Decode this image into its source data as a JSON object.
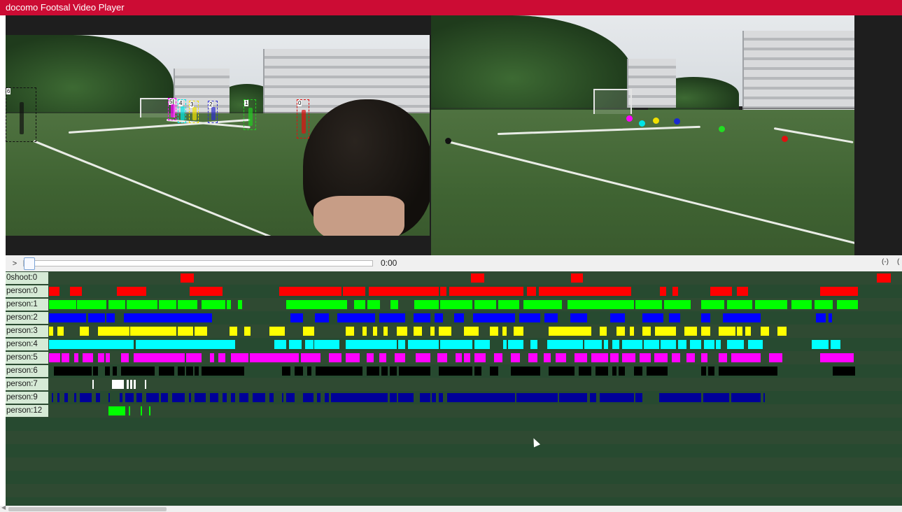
{
  "window": {
    "title": "docomo Footsal Video Player"
  },
  "controls": {
    "play_label": ">",
    "time": "0:00",
    "zoom_out_label": "(-)",
    "zoom_in_label": "("
  },
  "left_video": {
    "players": [
      {
        "id": "6",
        "color": "#111111"
      },
      {
        "id": "5",
        "color": "#ff00ff"
      },
      {
        "id": "4",
        "color": "#00e5e5"
      },
      {
        "id": "3",
        "color": "#f0e000"
      },
      {
        "id": "2",
        "color": "#2d2dcc"
      },
      {
        "id": "1",
        "color": "#22cc22"
      },
      {
        "id": "0",
        "color": "#e01010"
      }
    ]
  },
  "right_video": {
    "markers": [
      {
        "name": "person-6",
        "color": "#111111"
      },
      {
        "name": "person-5",
        "color": "#ff00ff"
      },
      {
        "name": "person-4",
        "color": "#00e5e5"
      },
      {
        "name": "person-3",
        "color": "#f0e000"
      },
      {
        "name": "person-2",
        "color": "#1a2ad0"
      },
      {
        "name": "person-1",
        "color": "#22dd22"
      },
      {
        "name": "person-0",
        "color": "#e01010"
      }
    ]
  },
  "timeline": {
    "rows": [
      {
        "label": "0shoot:0",
        "color": "#ff0000",
        "segments": [
          [
            0.155,
            0.171
          ],
          [
            0.498,
            0.514
          ],
          [
            0.616,
            0.63
          ],
          [
            0.977,
            0.993
          ]
        ]
      },
      {
        "label": "person:0",
        "color": "#ff0000",
        "segments": [
          [
            0.0,
            0.012
          ],
          [
            0.025,
            0.039
          ],
          [
            0.08,
            0.115
          ],
          [
            0.166,
            0.205
          ],
          [
            0.272,
            0.345
          ],
          [
            0.347,
            0.373
          ],
          [
            0.377,
            0.46
          ],
          [
            0.462,
            0.469
          ],
          [
            0.472,
            0.56
          ],
          [
            0.564,
            0.575
          ],
          [
            0.578,
            0.65
          ],
          [
            0.65,
            0.665
          ],
          [
            0.62,
            0.648
          ],
          [
            0.65,
            0.687
          ],
          [
            0.721,
            0.728
          ],
          [
            0.736,
            0.742
          ],
          [
            0.78,
            0.806
          ],
          [
            0.812,
            0.825
          ],
          [
            0.91,
            0.955
          ]
        ]
      },
      {
        "label": "person:1",
        "color": "#00ff00",
        "segments": [
          [
            0.0,
            0.032
          ],
          [
            0.033,
            0.068
          ],
          [
            0.07,
            0.09
          ],
          [
            0.092,
            0.128
          ],
          [
            0.13,
            0.15
          ],
          [
            0.152,
            0.175
          ],
          [
            0.18,
            0.208
          ],
          [
            0.21,
            0.215
          ],
          [
            0.223,
            0.228
          ],
          [
            0.28,
            0.33
          ],
          [
            0.33,
            0.352
          ],
          [
            0.36,
            0.373
          ],
          [
            0.376,
            0.391
          ],
          [
            0.403,
            0.412
          ],
          [
            0.431,
            0.46
          ],
          [
            0.462,
            0.5
          ],
          [
            0.502,
            0.528
          ],
          [
            0.53,
            0.555
          ],
          [
            0.56,
            0.605
          ],
          [
            0.612,
            0.69
          ],
          [
            0.692,
            0.723
          ],
          [
            0.726,
            0.757
          ],
          [
            0.77,
            0.797
          ],
          [
            0.8,
            0.83
          ],
          [
            0.833,
            0.871
          ],
          [
            0.876,
            0.9
          ],
          [
            0.903,
            0.925
          ],
          [
            0.93,
            0.955
          ]
        ]
      },
      {
        "label": "person:2",
        "color": "#0000ff",
        "segments": [
          [
            0.0,
            0.044
          ],
          [
            0.046,
            0.066
          ],
          [
            0.068,
            0.078
          ],
          [
            0.088,
            0.15
          ],
          [
            0.15,
            0.192
          ],
          [
            0.285,
            0.3
          ],
          [
            0.314,
            0.33
          ],
          [
            0.34,
            0.385
          ],
          [
            0.39,
            0.42
          ],
          [
            0.43,
            0.45
          ],
          [
            0.455,
            0.465
          ],
          [
            0.478,
            0.49
          ],
          [
            0.5,
            0.55
          ],
          [
            0.555,
            0.58
          ],
          [
            0.585,
            0.6
          ],
          [
            0.615,
            0.635
          ],
          [
            0.662,
            0.68
          ],
          [
            0.7,
            0.725
          ],
          [
            0.732,
            0.745
          ],
          [
            0.77,
            0.78
          ],
          [
            0.795,
            0.84
          ],
          [
            0.905,
            0.917
          ],
          [
            0.92,
            0.924
          ]
        ]
      },
      {
        "label": "person:3",
        "color": "#ffff00",
        "segments": [
          [
            0.0,
            0.005
          ],
          [
            0.01,
            0.017
          ],
          [
            0.036,
            0.047
          ],
          [
            0.058,
            0.095
          ],
          [
            0.096,
            0.15
          ],
          [
            0.152,
            0.17
          ],
          [
            0.172,
            0.187
          ],
          [
            0.213,
            0.222
          ],
          [
            0.23,
            0.238
          ],
          [
            0.26,
            0.278
          ],
          [
            0.3,
            0.313
          ],
          [
            0.35,
            0.36
          ],
          [
            0.37,
            0.375
          ],
          [
            0.382,
            0.387
          ],
          [
            0.395,
            0.4
          ],
          [
            0.41,
            0.423
          ],
          [
            0.43,
            0.44
          ],
          [
            0.45,
            0.455
          ],
          [
            0.46,
            0.475
          ],
          [
            0.49,
            0.507
          ],
          [
            0.52,
            0.53
          ],
          [
            0.535,
            0.54
          ],
          [
            0.548,
            0.56
          ],
          [
            0.59,
            0.64
          ],
          [
            0.65,
            0.658
          ],
          [
            0.67,
            0.68
          ],
          [
            0.685,
            0.69
          ],
          [
            0.7,
            0.71
          ],
          [
            0.715,
            0.74
          ],
          [
            0.75,
            0.765
          ],
          [
            0.77,
            0.78
          ],
          [
            0.79,
            0.81
          ],
          [
            0.812,
            0.818
          ],
          [
            0.822,
            0.828
          ],
          [
            0.84,
            0.85
          ],
          [
            0.86,
            0.87
          ]
        ]
      },
      {
        "label": "person:4",
        "color": "#00ffff",
        "segments": [
          [
            0.0,
            0.1
          ],
          [
            0.102,
            0.22
          ],
          [
            0.266,
            0.28
          ],
          [
            0.283,
            0.298
          ],
          [
            0.302,
            0.312
          ],
          [
            0.313,
            0.343
          ],
          [
            0.35,
            0.41
          ],
          [
            0.412,
            0.42
          ],
          [
            0.424,
            0.46
          ],
          [
            0.462,
            0.5
          ],
          [
            0.502,
            0.52
          ],
          [
            0.536,
            0.54
          ],
          [
            0.542,
            0.56
          ],
          [
            0.568,
            0.576
          ],
          [
            0.588,
            0.63
          ],
          [
            0.632,
            0.652
          ],
          [
            0.655,
            0.66
          ],
          [
            0.665,
            0.673
          ],
          [
            0.676,
            0.7
          ],
          [
            0.702,
            0.72
          ],
          [
            0.722,
            0.74
          ],
          [
            0.742,
            0.752
          ],
          [
            0.756,
            0.77
          ],
          [
            0.773,
            0.785
          ],
          [
            0.787,
            0.793
          ],
          [
            0.8,
            0.82
          ],
          [
            0.825,
            0.842
          ],
          [
            0.9,
            0.92
          ],
          [
            0.922,
            0.934
          ]
        ]
      },
      {
        "label": "person:5",
        "color": "#ff00ff",
        "segments": [
          [
            0.0,
            0.013
          ],
          [
            0.015,
            0.024
          ],
          [
            0.03,
            0.035
          ],
          [
            0.04,
            0.052
          ],
          [
            0.058,
            0.065
          ],
          [
            0.067,
            0.072
          ],
          [
            0.085,
            0.094
          ],
          [
            0.1,
            0.16
          ],
          [
            0.162,
            0.18
          ],
          [
            0.19,
            0.195
          ],
          [
            0.2,
            0.208
          ],
          [
            0.215,
            0.235
          ],
          [
            0.237,
            0.295
          ],
          [
            0.297,
            0.32
          ],
          [
            0.33,
            0.345
          ],
          [
            0.35,
            0.367
          ],
          [
            0.375,
            0.383
          ],
          [
            0.39,
            0.398
          ],
          [
            0.408,
            0.42
          ],
          [
            0.433,
            0.45
          ],
          [
            0.458,
            0.47
          ],
          [
            0.48,
            0.487
          ],
          [
            0.49,
            0.497
          ],
          [
            0.502,
            0.515
          ],
          [
            0.525,
            0.535
          ],
          [
            0.545,
            0.556
          ],
          [
            0.566,
            0.576
          ],
          [
            0.584,
            0.592
          ],
          [
            0.598,
            0.61
          ],
          [
            0.62,
            0.635
          ],
          [
            0.64,
            0.66
          ],
          [
            0.662,
            0.672
          ],
          [
            0.676,
            0.692
          ],
          [
            0.697,
            0.71
          ],
          [
            0.714,
            0.73
          ],
          [
            0.735,
            0.745
          ],
          [
            0.752,
            0.762
          ],
          [
            0.77,
            0.777
          ],
          [
            0.79,
            0.8
          ],
          [
            0.805,
            0.84
          ],
          [
            0.85,
            0.865
          ],
          [
            0.91,
            0.95
          ]
        ]
      },
      {
        "label": "person:6",
        "color": "#000000",
        "segments": [
          [
            0.006,
            0.05
          ],
          [
            0.052,
            0.058
          ],
          [
            0.066,
            0.072
          ],
          [
            0.075,
            0.08
          ],
          [
            0.085,
            0.125
          ],
          [
            0.13,
            0.148
          ],
          [
            0.152,
            0.16
          ],
          [
            0.162,
            0.17
          ],
          [
            0.172,
            0.177
          ],
          [
            0.18,
            0.23
          ],
          [
            0.275,
            0.285
          ],
          [
            0.29,
            0.3
          ],
          [
            0.305,
            0.31
          ],
          [
            0.315,
            0.37
          ],
          [
            0.375,
            0.39
          ],
          [
            0.392,
            0.4
          ],
          [
            0.402,
            0.41
          ],
          [
            0.413,
            0.45
          ],
          [
            0.46,
            0.5
          ],
          [
            0.502,
            0.51
          ],
          [
            0.52,
            0.53
          ],
          [
            0.545,
            0.58
          ],
          [
            0.59,
            0.62
          ],
          [
            0.625,
            0.64
          ],
          [
            0.645,
            0.66
          ],
          [
            0.665,
            0.67
          ],
          [
            0.672,
            0.68
          ],
          [
            0.69,
            0.7
          ],
          [
            0.705,
            0.73
          ],
          [
            0.77,
            0.775
          ],
          [
            0.778,
            0.785
          ],
          [
            0.79,
            0.83
          ],
          [
            0.83,
            0.86
          ],
          [
            0.925,
            0.951
          ]
        ]
      },
      {
        "label": "person:7",
        "color": "#ffffff",
        "segments": [
          [
            0.051,
            0.053
          ],
          [
            0.074,
            0.088
          ],
          [
            0.092,
            0.094
          ],
          [
            0.096,
            0.098
          ],
          [
            0.1,
            0.102
          ],
          [
            0.113,
            0.115
          ]
        ]
      },
      {
        "label": "person:9",
        "color": "#000099",
        "segments": [
          [
            0.003,
            0.005
          ],
          [
            0.01,
            0.012
          ],
          [
            0.018,
            0.022
          ],
          [
            0.03,
            0.032
          ],
          [
            0.036,
            0.05
          ],
          [
            0.055,
            0.06
          ],
          [
            0.07,
            0.072
          ],
          [
            0.083,
            0.087
          ],
          [
            0.09,
            0.1
          ],
          [
            0.103,
            0.11
          ],
          [
            0.115,
            0.13
          ],
          [
            0.132,
            0.14
          ],
          [
            0.145,
            0.16
          ],
          [
            0.165,
            0.168
          ],
          [
            0.172,
            0.185
          ],
          [
            0.19,
            0.2
          ],
          [
            0.205,
            0.21
          ],
          [
            0.215,
            0.22
          ],
          [
            0.225,
            0.235
          ],
          [
            0.24,
            0.255
          ],
          [
            0.26,
            0.265
          ],
          [
            0.275,
            0.277
          ],
          [
            0.28,
            0.29
          ],
          [
            0.3,
            0.312
          ],
          [
            0.316,
            0.32
          ],
          [
            0.325,
            0.33
          ],
          [
            0.333,
            0.4
          ],
          [
            0.402,
            0.41
          ],
          [
            0.412,
            0.43
          ],
          [
            0.438,
            0.45
          ],
          [
            0.452,
            0.457
          ],
          [
            0.46,
            0.465
          ],
          [
            0.47,
            0.55
          ],
          [
            0.552,
            0.6
          ],
          [
            0.602,
            0.635
          ],
          [
            0.638,
            0.646
          ],
          [
            0.65,
            0.66
          ],
          [
            0.66,
            0.69
          ],
          [
            0.692,
            0.7
          ],
          [
            0.72,
            0.77
          ],
          [
            0.772,
            0.803
          ],
          [
            0.805,
            0.84
          ],
          [
            0.843,
            0.845
          ]
        ]
      },
      {
        "label": "person:12",
        "color": "#00ff00",
        "segments": [
          [
            0.07,
            0.09
          ],
          [
            0.094,
            0.096
          ],
          [
            0.108,
            0.11
          ],
          [
            0.118,
            0.12
          ]
        ]
      }
    ],
    "empty_rows": 8
  },
  "colors": {
    "titlebar": "#cc0c34",
    "timeline_bg": "#2d4a30",
    "timeline_alt": "#274a30",
    "label_bg": "#d6ead6"
  }
}
